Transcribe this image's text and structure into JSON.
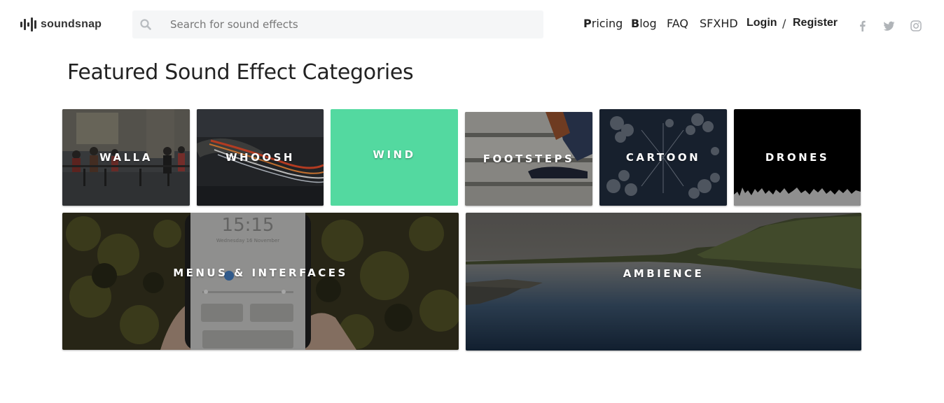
{
  "header": {
    "logo_text": "soundsnap",
    "search": {
      "placeholder": "Search for sound effects",
      "value": ""
    },
    "nav": {
      "pricing": {
        "first": "P",
        "rest": "ricing"
      },
      "blog": {
        "first": "B",
        "rest": "log"
      },
      "faq": "FAQ",
      "sfxhd": "SFXHD",
      "login": "Login",
      "separator": "/",
      "register": "Register"
    },
    "social_icons": [
      "facebook-icon",
      "twitter-icon",
      "instagram-icon"
    ]
  },
  "main": {
    "title": "Featured Sound Effect Categories",
    "categories_row1": [
      {
        "label": "WALLA"
      },
      {
        "label": "WHOOSH"
      },
      {
        "label": "WIND"
      },
      {
        "label": "FOOTSTEPS"
      },
      {
        "label": "CARTOON"
      },
      {
        "label": "DRONES"
      }
    ],
    "categories_row2": [
      {
        "label": "MENUS & INTERFACES",
        "phone_time": "15:15",
        "phone_date": "Wednesday 16 November"
      },
      {
        "label": "AMBIENCE"
      }
    ]
  },
  "colors": {
    "wind_tile": "#53d9a0",
    "text_dark": "#222222",
    "search_bg": "#f5f6f7"
  }
}
